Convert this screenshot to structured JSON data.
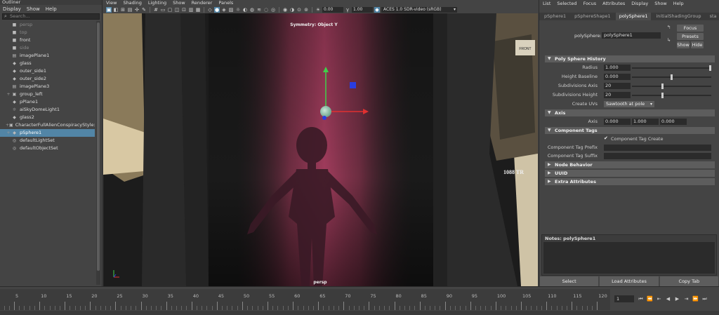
{
  "outliner": {
    "title": "Outliner",
    "menu": [
      "Display",
      "Show",
      "Help"
    ],
    "search_placeholder": "Search...",
    "items": [
      {
        "label": "persp",
        "icon": "camera-icon",
        "dim": true,
        "exp": ""
      },
      {
        "label": "top",
        "icon": "camera-icon",
        "dim": true,
        "exp": ""
      },
      {
        "label": "front",
        "icon": "camera-icon",
        "dim": false,
        "exp": ""
      },
      {
        "label": "side",
        "icon": "camera-icon",
        "dim": true,
        "exp": ""
      },
      {
        "label": "imagePlane1",
        "icon": "image-plane-icon",
        "dim": false,
        "exp": ""
      },
      {
        "label": "glass",
        "icon": "mesh-icon",
        "dim": false,
        "exp": ""
      },
      {
        "label": "outer_side1",
        "icon": "mesh-icon",
        "dim": false,
        "exp": ""
      },
      {
        "label": "outer_side2",
        "icon": "mesh-icon",
        "dim": false,
        "exp": ""
      },
      {
        "label": "imagePlane3",
        "icon": "image-plane-icon",
        "dim": false,
        "exp": ""
      },
      {
        "label": "group_left",
        "icon": "group-icon",
        "dim": false,
        "exp": "+"
      },
      {
        "label": "pPlane1",
        "icon": "mesh-icon",
        "dim": false,
        "exp": ""
      },
      {
        "label": "aiSkyDomeLight1",
        "icon": "light-icon",
        "dim": false,
        "exp": ""
      },
      {
        "label": "glass2",
        "icon": "mesh-icon",
        "dim": false,
        "exp": ""
      },
      {
        "label": "CharacterFullAlienConspiracyStyle:Ali",
        "icon": "group-icon",
        "dim": false,
        "exp": "+"
      },
      {
        "label": "pSphere1",
        "icon": "mesh-icon",
        "dim": false,
        "exp": "+",
        "selected": true
      },
      {
        "label": "defaultLightSet",
        "icon": "set-icon",
        "dim": false,
        "exp": ""
      },
      {
        "label": "defaultObjectSet",
        "icon": "set-icon",
        "dim": false,
        "exp": ""
      }
    ]
  },
  "viewport": {
    "menu": [
      "View",
      "Shading",
      "Lighting",
      "Show",
      "Renderer",
      "Panels"
    ],
    "exposure": "0.00",
    "gamma": "1.00",
    "color_management": "ACES 1.0 SDR-video (sRGB)",
    "symmetry_label": "Symmetry: Object Y",
    "camera_label": "persp",
    "scene_text": [
      "FRONT",
      "1088 TR"
    ],
    "colors": {
      "beam": "#a03c5c",
      "selection": "#5285a6"
    }
  },
  "attribute_editor": {
    "menu": [
      "List",
      "Selected",
      "Focus",
      "Attributes",
      "Display",
      "Show",
      "Help"
    ],
    "tabs": [
      "pSphere1",
      "pSphereShape1",
      "polySphere1",
      "initialShadingGroup",
      "sta"
    ],
    "active_tab": "polySphere1",
    "node_label": "polySphere:",
    "node_name": "polySphere1",
    "buttons": {
      "focus": "Focus",
      "presets": "Presets",
      "show": "Show",
      "hide": "Hide"
    },
    "sections": {
      "history": "Poly Sphere History",
      "axis": "Axis",
      "tags": "Component Tags",
      "node_behavior": "Node Behavior",
      "uuid": "UUID",
      "extra": "Extra Attributes"
    },
    "attrs": {
      "radius": {
        "label": "Radius",
        "value": "1.000",
        "slider": 1.0
      },
      "height_baseline": {
        "label": "Height Baseline",
        "value": "0.000",
        "slider": 0.5
      },
      "subdiv_axis": {
        "label": "Subdivisions Axis",
        "value": "20",
        "slider": 0.38
      },
      "subdiv_height": {
        "label": "Subdivisions Height",
        "value": "20",
        "slider": 0.38
      },
      "create_uvs": {
        "label": "Create UVs",
        "value": "Sawtooth at pole"
      },
      "axis": {
        "label": "Axis",
        "x": "0.000",
        "y": "1.000",
        "z": "0.000"
      },
      "tag_create": {
        "label": "Component Tag Create",
        "checked": true
      },
      "tag_prefix": {
        "label": "Component Tag Prefix",
        "value": ""
      },
      "tag_suffix": {
        "label": "Component Tag Suffix",
        "value": ""
      }
    },
    "notes_label": "Notes:  polySphere1",
    "bottom_buttons": [
      "Select",
      "Load Attributes",
      "Copy Tab"
    ]
  },
  "timeline": {
    "ticks": [
      "5",
      "10",
      "15",
      "20",
      "25",
      "30",
      "35",
      "40",
      "45",
      "50",
      "55",
      "60",
      "65",
      "70",
      "75",
      "80",
      "85",
      "90",
      "95",
      "100",
      "105",
      "110",
      "115",
      "120"
    ],
    "current_frame": "1"
  }
}
